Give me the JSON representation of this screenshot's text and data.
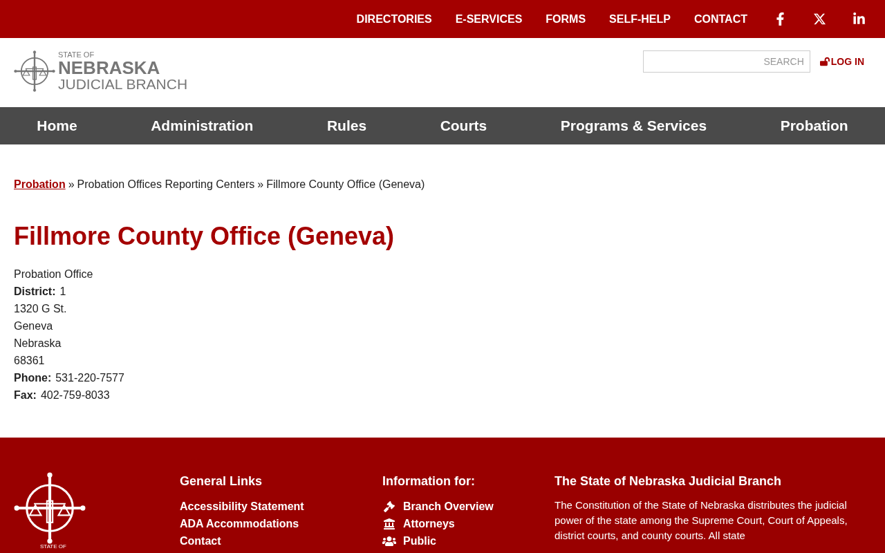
{
  "top_bar": {
    "links": [
      "DIRECTORIES",
      "E-SERVICES",
      "FORMS",
      "SELF-HELP",
      "CONTACT"
    ],
    "social": [
      {
        "kind": "facebook"
      },
      {
        "kind": "x"
      },
      {
        "kind": "linkedin"
      }
    ]
  },
  "header": {
    "logo": {
      "small": "STATE OF",
      "big": "NEBRASKA",
      "sub": "JUDICIAL BRANCH"
    },
    "search": {
      "placeholder": "SEARCH"
    },
    "login": "LOG IN"
  },
  "nav": [
    "Home",
    "Administration",
    "Rules",
    "Courts",
    "Programs & Services",
    "Probation"
  ],
  "breadcrumb": [
    {
      "label": "Probation",
      "link": true
    },
    {
      "label": "Probation Offices Reporting Centers",
      "link": false
    },
    {
      "label": "Fillmore County Office (Geneva)",
      "link": false
    }
  ],
  "breadcrumb_separator": "»",
  "title": "Fillmore County Office (Geneva)",
  "details": [
    {
      "value": "Probation Office"
    },
    {
      "label": "District:",
      "value": "1"
    },
    {
      "value": "1320 G St."
    },
    {
      "value": "Geneva"
    },
    {
      "value": "Nebraska"
    },
    {
      "value": "68361"
    },
    {
      "label": "Phone:",
      "value": "531-220-7577"
    },
    {
      "label": "Fax:",
      "value": "402-759-8033"
    }
  ],
  "footer": {
    "logo_small": "STATE OF",
    "general_links": {
      "heading": "General Links",
      "items": [
        "Accessibility Statement",
        "ADA Accommodations",
        "Contact"
      ]
    },
    "information_for": {
      "heading": "Information for:",
      "items": [
        {
          "kind": "gavel",
          "label": "Branch Overview"
        },
        {
          "kind": "building",
          "label": "Attorneys"
        },
        {
          "kind": "people",
          "label": "Public"
        }
      ]
    },
    "about": {
      "heading": "The State of Nebraska Judicial Branch",
      "text": "The Constitution of the State of Nebraska distributes the judicial power of the state among the Supreme Court, Court of Appeals, district courts, and county courts.  All state"
    }
  }
}
